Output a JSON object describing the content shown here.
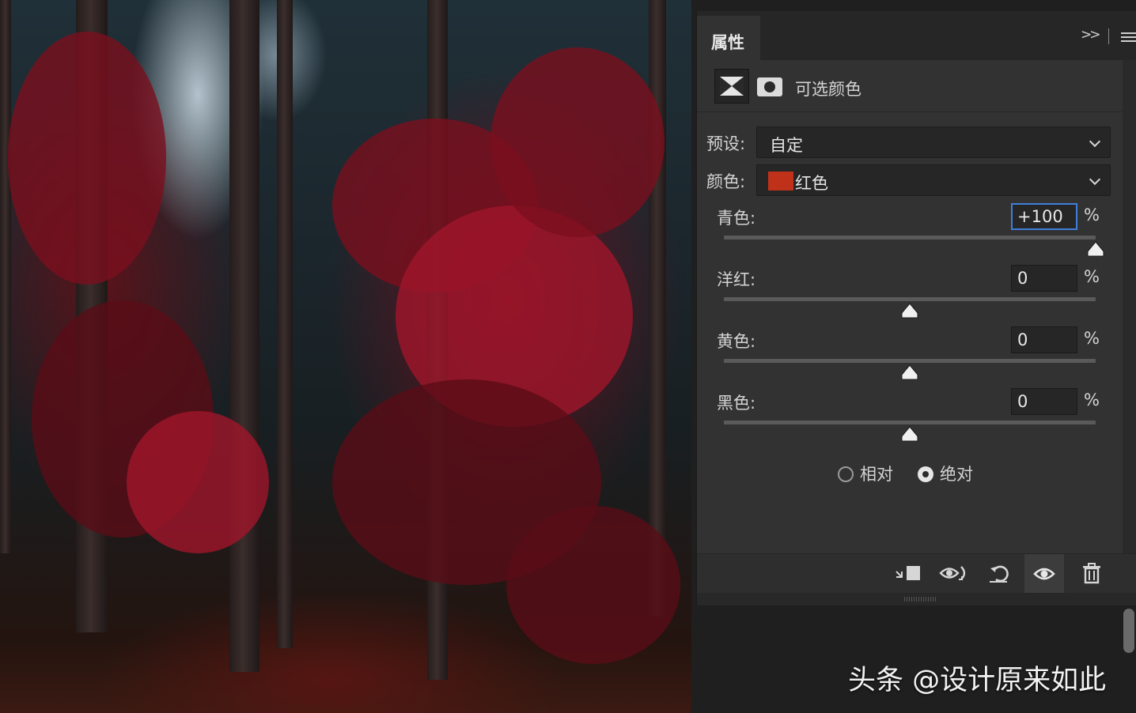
{
  "panel": {
    "tab_title": "属性",
    "adjustment_title": "可选颜色",
    "preset_label": "预设:",
    "preset_value": "自定",
    "colors_label": "颜色:",
    "colors_value": "红色",
    "colors_swatch": "#c0311a",
    "sliders": [
      {
        "label": "青色:",
        "value": "+100",
        "unit": "%",
        "percent": 100
      },
      {
        "label": "洋红:",
        "value": "0",
        "unit": "%",
        "percent": 0
      },
      {
        "label": "黄色:",
        "value": "0",
        "unit": "%",
        "percent": 0
      },
      {
        "label": "黑色:",
        "value": "0",
        "unit": "%",
        "percent": 0
      }
    ],
    "method": {
      "options": [
        "相对",
        "绝对"
      ],
      "selected": "绝对"
    },
    "footer_icons": [
      "clip-to-layer-icon",
      "view-previous-state-icon",
      "reset-icon",
      "visibility-icon",
      "delete-icon"
    ]
  },
  "watermark": "头条 @设计原来如此",
  "colors": {
    "active_input_border": "#3f7fd9",
    "panel_bg": "#323232"
  }
}
